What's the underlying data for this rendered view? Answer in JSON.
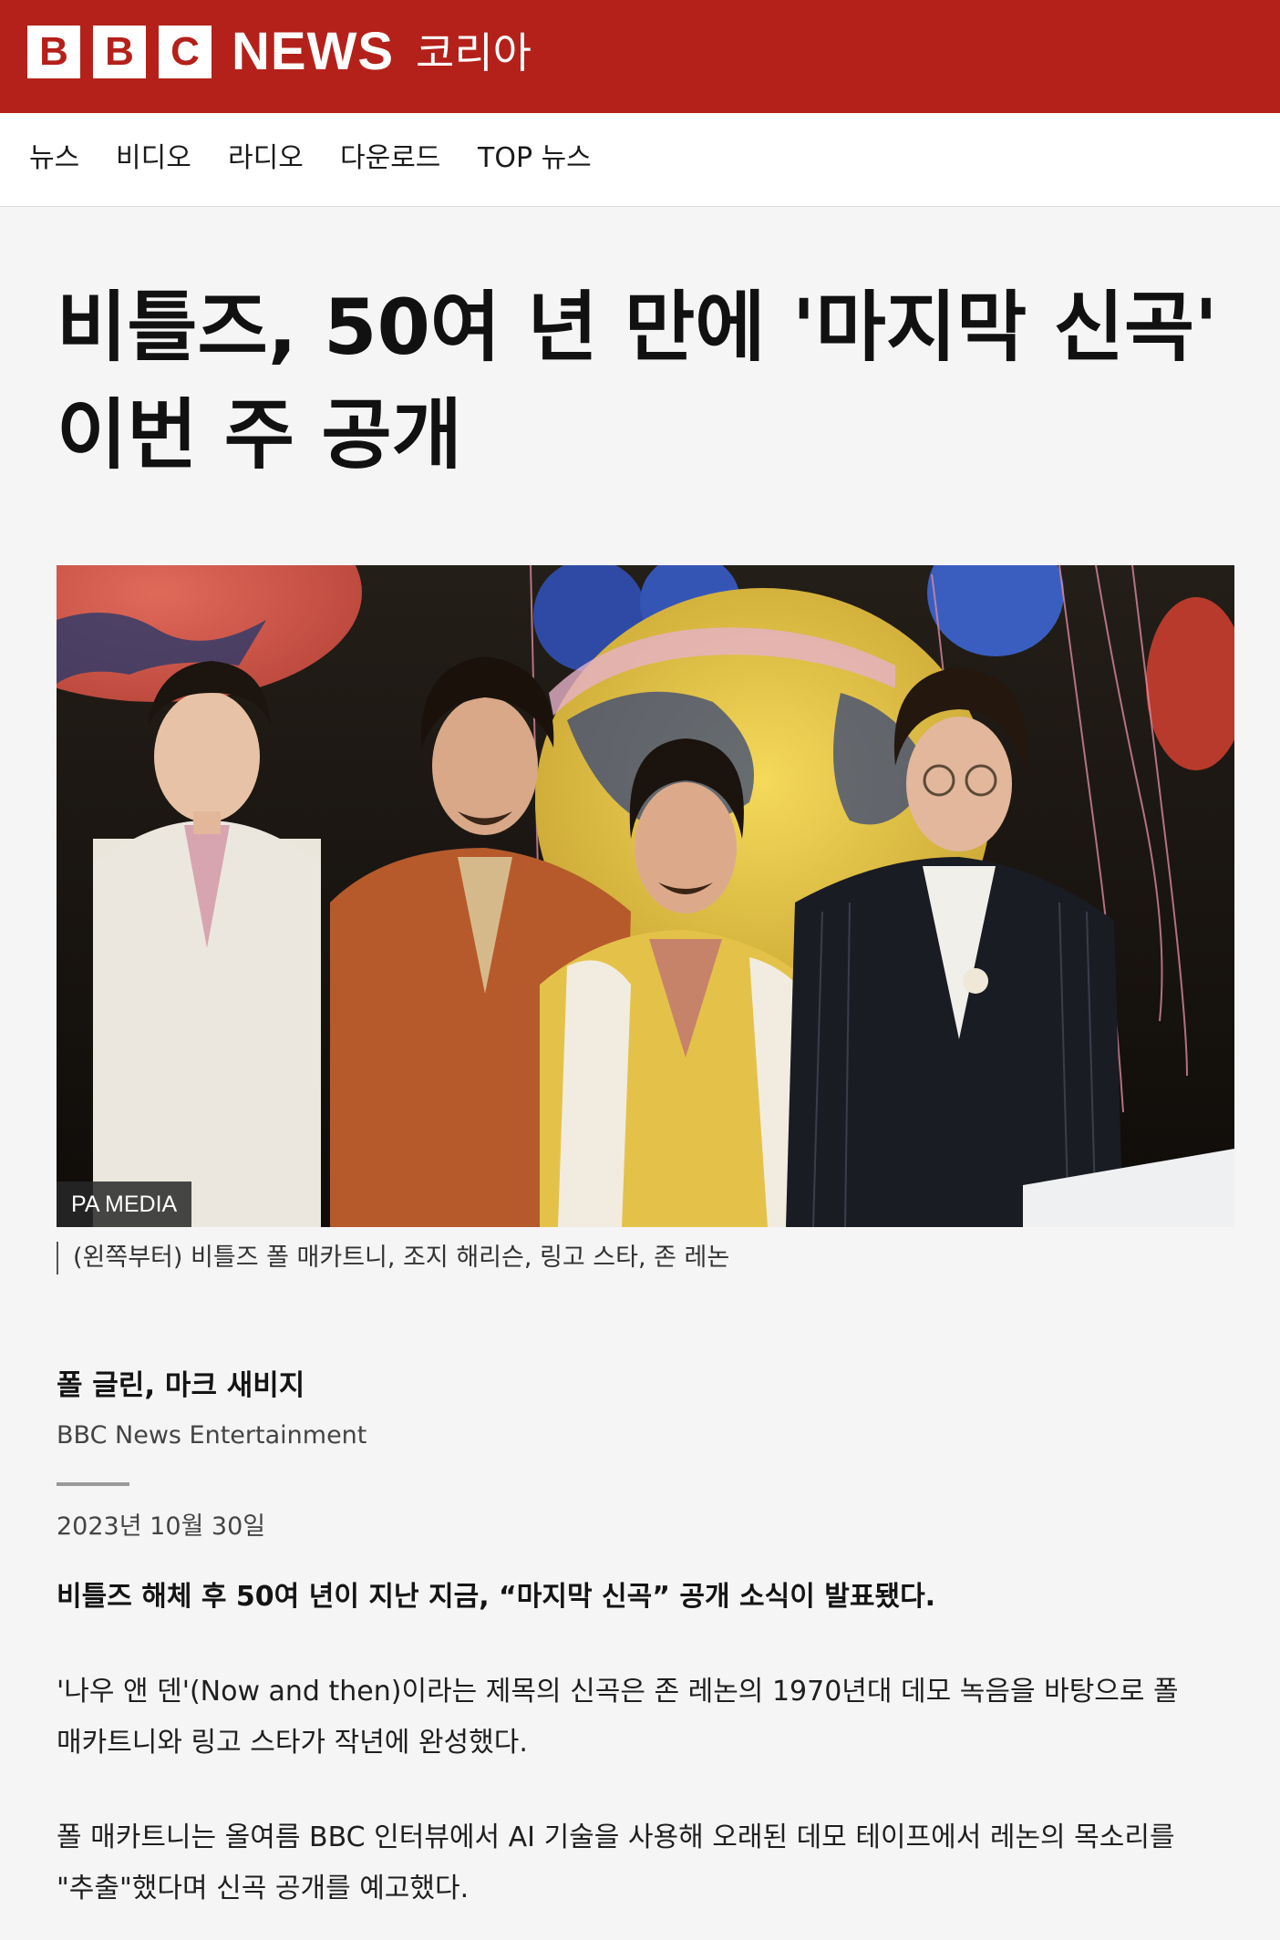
{
  "header": {
    "logo_letters": [
      "B",
      "B",
      "C"
    ],
    "logo_news": "NEWS",
    "logo_region": "코리아",
    "background_color": "#b4211a"
  },
  "nav": {
    "items": [
      {
        "label": "뉴스"
      },
      {
        "label": "비디오"
      },
      {
        "label": "라디오"
      },
      {
        "label": "다운로드"
      },
      {
        "label": "TOP 뉴스"
      }
    ]
  },
  "article": {
    "headline": "비틀즈, 50여 년 만에 '마지막 신곡' 이번 주 공개",
    "image": {
      "credit": "PA MEDIA",
      "caption": "(왼쪽부터) 비틀즈 폴 매카트니, 조지 해리슨, 링고 스타, 존 레논"
    },
    "byline": {
      "authors": "폴 글린, 마크 새비지",
      "role": "BBC News Entertainment"
    },
    "date": "2023년 10월 30일",
    "lede": "비틀즈 해체 후 50여 년이 지난 지금, “마지막 신곡” 공개 소식이 발표됐다.",
    "paragraphs": [
      "'나우 앤 덴'(Now and then)이라는 제목의 신곡은 존 레논의 1970년대 데모 녹음을 바탕으로 폴 매카트니와 링고 스타가 작년에 완성했다.",
      "폴 매카트니는 올여름 BBC 인터뷰에서 AI 기술을 사용해 오래된 데모 테이프에서 레논의 목소리를 \"추출\"했다며 신곡 공개를 예고했다."
    ]
  }
}
